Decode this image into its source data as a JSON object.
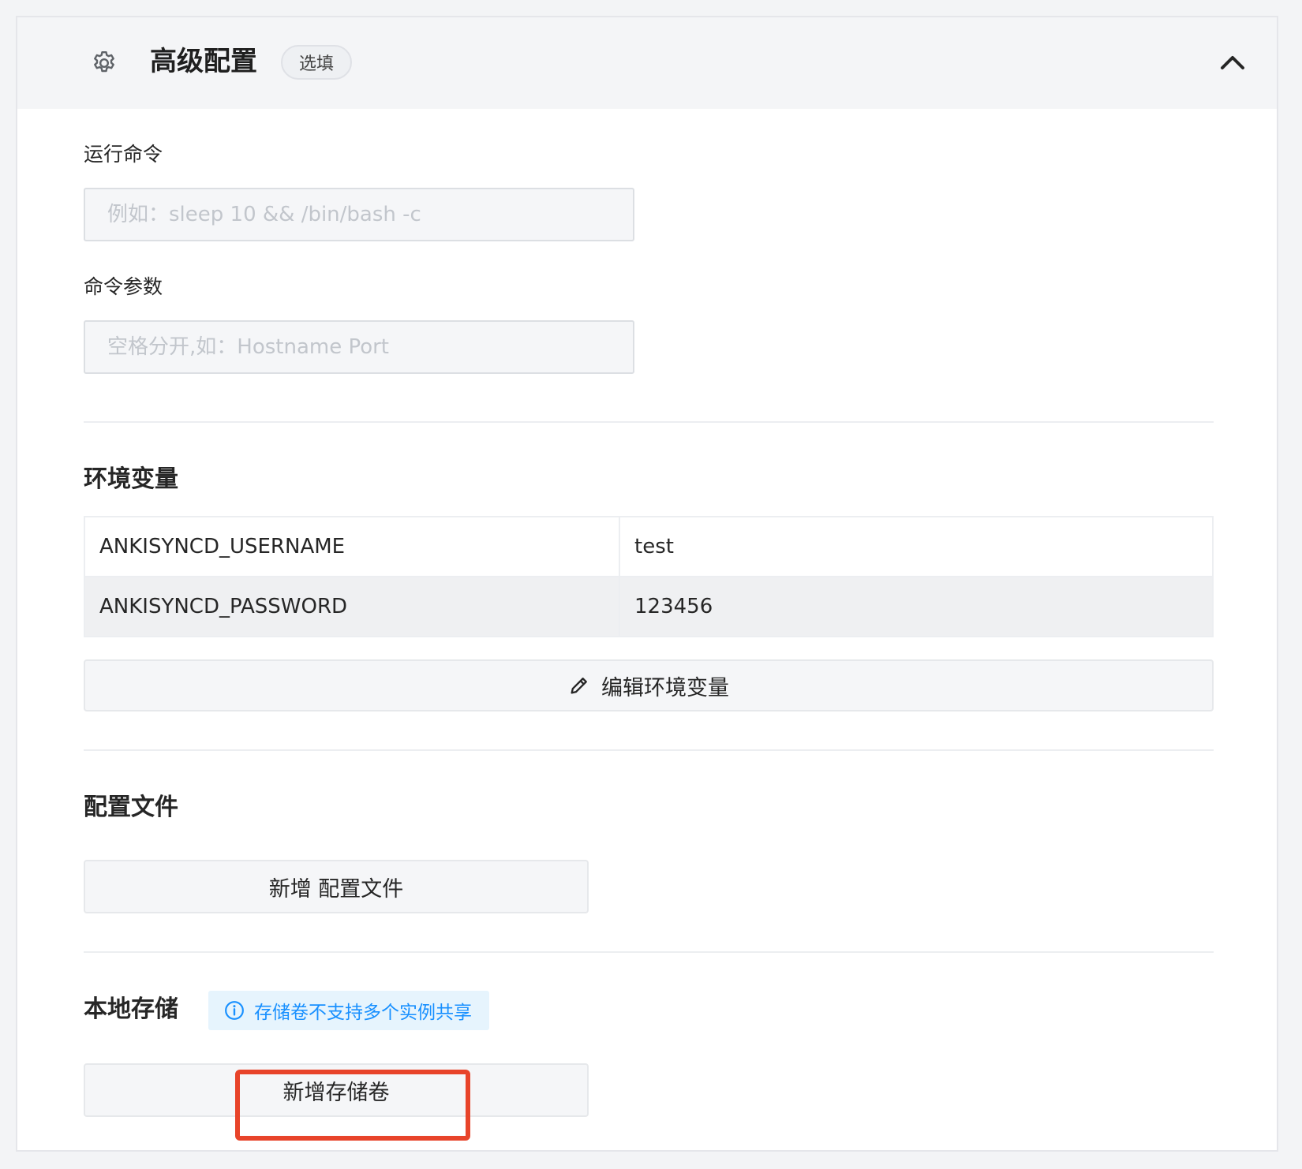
{
  "header": {
    "title": "高级配置",
    "badge": "选填",
    "gear_icon": "gear-icon",
    "collapse_icon": "chevron-up-icon"
  },
  "run_command": {
    "label": "运行命令",
    "placeholder": "例如：sleep 10 && /bin/bash -c",
    "value": ""
  },
  "command_args": {
    "label": "命令参数",
    "placeholder": "空格分开,如：Hostname Port",
    "value": ""
  },
  "env": {
    "title": "环境变量",
    "rows": [
      {
        "key": "ANKISYNCD_USERNAME",
        "value": "test"
      },
      {
        "key": "ANKISYNCD_PASSWORD",
        "value": "123456"
      }
    ],
    "edit_button": "编辑环境变量",
    "edit_icon": "pencil-icon"
  },
  "config_files": {
    "title": "配置文件",
    "add_button": "新增 配置文件"
  },
  "local_storage": {
    "title": "本地存储",
    "info": "存储卷不支持多个实例共享",
    "info_icon": "info-icon",
    "add_button": "新增存储卷"
  },
  "colors": {
    "accent": "#1890ff",
    "highlight": "#e8442a"
  }
}
